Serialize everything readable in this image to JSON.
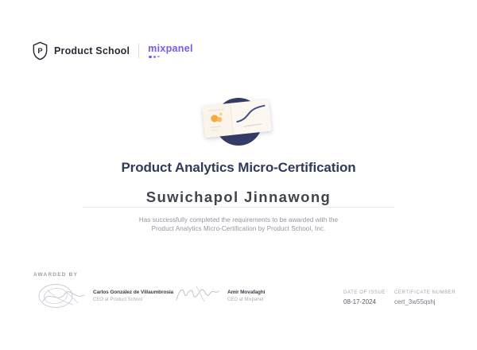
{
  "header": {
    "product_school_label": "Product School",
    "mixpanel_label": "mixpanel"
  },
  "certificate": {
    "title": "Product Analytics Micro-Certification",
    "recipient": "Suwichapol Jinnawong",
    "description_line1": "Has successfully completed the requirements to be awarded with the",
    "description_line2": "Product Analytics Micro-Certification by Product School, Inc."
  },
  "footer": {
    "awarded_by_label": "AWARDED BY",
    "signers": [
      {
        "name": "Carlos González de Villaumbrosia",
        "title": "CEO at Product School"
      },
      {
        "name": "Amir Movafaghi",
        "title": "CEO at Mixpanel"
      }
    ],
    "date_of_issue": {
      "label": "DATE OF ISSUE",
      "value": "08-17-2024"
    },
    "certificate_number": {
      "label": "CERTIFICATE NUMBER",
      "value": "cert_3w55qshj"
    }
  },
  "icons": {
    "product_school_shield": "shield-with-p",
    "mixpanel_dots": "three-purple-dots",
    "illustration": "dashboard-card-over-navy-circle"
  },
  "colors": {
    "navy_title": "#2f3b5c",
    "circle_navy": "#343c68",
    "mixpanel_purple": "#7856ff",
    "orange_chart": "#f6a93c",
    "gray_text": "#91969e",
    "card_cream": "#fcf8f1"
  }
}
